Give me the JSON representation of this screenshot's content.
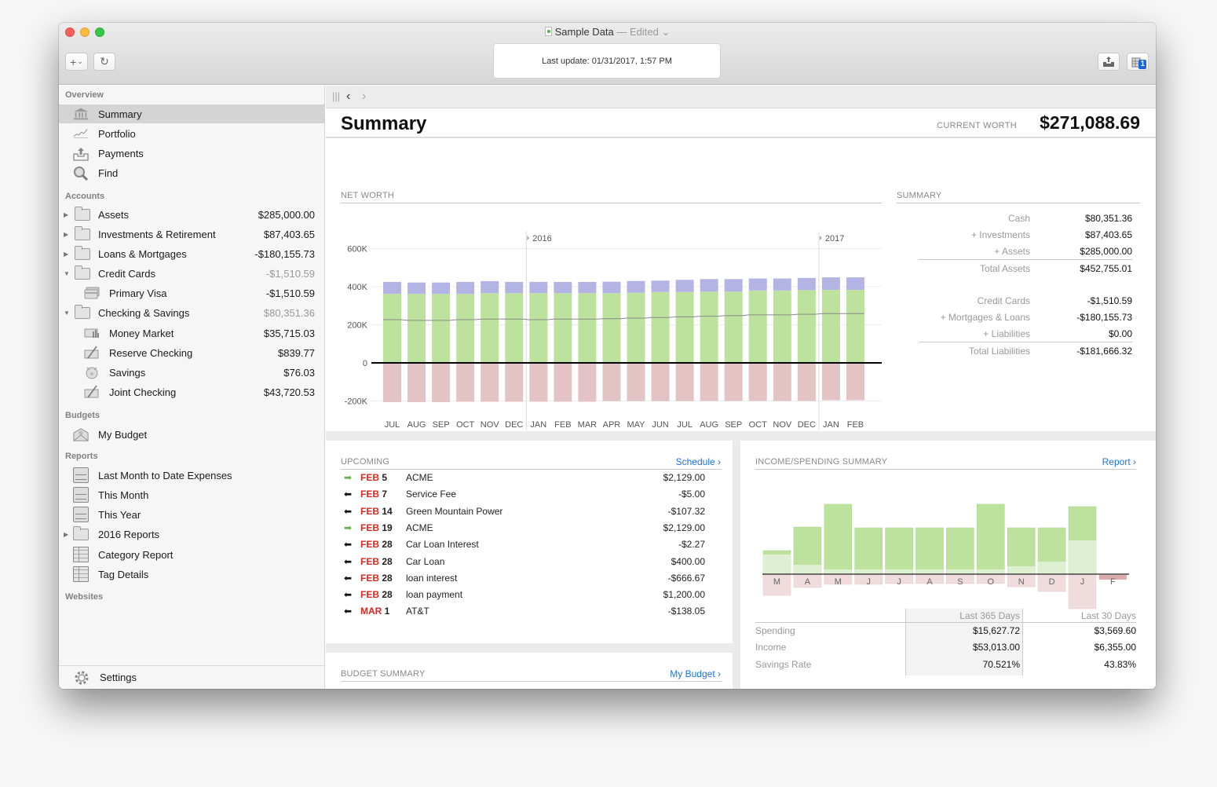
{
  "window": {
    "title": "Sample Data",
    "edited_label": "— Edited",
    "last_update": "Last update:  01/31/2017, 1:57 PM"
  },
  "toolbar": {
    "add_label": "+",
    "refresh_icon": "refresh-icon",
    "badge_count": "1"
  },
  "sidebar": {
    "sections": {
      "overview": "Overview",
      "accounts": "Accounts",
      "budgets": "Budgets",
      "reports": "Reports",
      "websites": "Websites"
    },
    "overview_items": [
      {
        "label": "Summary",
        "icon": "bank-icon",
        "selected": true
      },
      {
        "label": "Portfolio",
        "icon": "portfolio-chart-icon"
      },
      {
        "label": "Payments",
        "icon": "upload-tray-icon"
      },
      {
        "label": "Find",
        "icon": "magnifier-icon"
      }
    ],
    "accounts": [
      {
        "label": "Assets",
        "amount": "$285,000.00",
        "expanded": false
      },
      {
        "label": "Investments & Retirement",
        "amount": "$87,403.65",
        "expanded": false
      },
      {
        "label": "Loans & Mortgages",
        "amount": "-$180,155.73",
        "expanded": false
      },
      {
        "label": "Credit Cards",
        "amount": "-$1,510.59",
        "expanded": true
      },
      {
        "label": "Primary Visa",
        "amount": "-$1,510.59",
        "child": true
      },
      {
        "label": "Checking & Savings",
        "amount": "$80,351.36",
        "expanded": true
      },
      {
        "label": "Money Market",
        "amount": "$35,715.03",
        "child": true
      },
      {
        "label": "Reserve Checking",
        "amount": "$839.77",
        "child": true
      },
      {
        "label": "Savings",
        "amount": "$76.03",
        "child": true
      },
      {
        "label": "Joint Checking",
        "amount": "$43,720.53",
        "child": true
      }
    ],
    "budgets": [
      {
        "label": "My Budget"
      }
    ],
    "reports": [
      {
        "label": "Last Month to Date Expenses"
      },
      {
        "label": "This Month"
      },
      {
        "label": "This Year"
      },
      {
        "label": "2016 Reports"
      },
      {
        "label": "Category Report"
      },
      {
        "label": "Tag Details"
      }
    ],
    "settings_label": "Settings"
  },
  "page": {
    "title": "Summary",
    "current_worth_label": "CURRENT WORTH",
    "current_worth_value": "$271,088.69"
  },
  "net_worth": {
    "section_title": "NET WORTH"
  },
  "summary": {
    "section_title": "SUMMARY",
    "assets": [
      {
        "label": "Cash",
        "value": "$80,351.36"
      },
      {
        "label": "+ Investments",
        "value": "$87,403.65"
      },
      {
        "label": "+ Assets",
        "value": "$285,000.00"
      }
    ],
    "total_assets": {
      "label": "Total Assets",
      "value": "$452,755.01"
    },
    "liabilities": [
      {
        "label": "Credit Cards",
        "value": "-$1,510.59"
      },
      {
        "label": "+ Mortgages & Loans",
        "value": "-$180,155.73"
      },
      {
        "label": "+ Liabilities",
        "value": "$0.00"
      }
    ],
    "total_liabilities": {
      "label": "Total Liabilities",
      "value": "-$181,666.32"
    }
  },
  "upcoming": {
    "section_title": "UPCOMING",
    "link_label": "Schedule ›",
    "rows": [
      {
        "direction": "in",
        "month": "FEB",
        "day": "5",
        "payee": "ACME",
        "amount": "$2,129.00"
      },
      {
        "direction": "out",
        "month": "FEB",
        "day": "7",
        "payee": "Service Fee",
        "amount": "-$5.00"
      },
      {
        "direction": "out",
        "month": "FEB",
        "day": "14",
        "payee": "Green Mountain Power",
        "amount": "-$107.32"
      },
      {
        "direction": "in",
        "month": "FEB",
        "day": "19",
        "payee": "ACME",
        "amount": "$2,129.00"
      },
      {
        "direction": "out",
        "month": "FEB",
        "day": "28",
        "payee": "Car Loan Interest",
        "amount": "-$2.27"
      },
      {
        "direction": "out",
        "month": "FEB",
        "day": "28",
        "payee": "Car Loan",
        "amount": "$400.00"
      },
      {
        "direction": "out",
        "month": "FEB",
        "day": "28",
        "payee": "loan interest",
        "amount": "-$666.67"
      },
      {
        "direction": "out",
        "month": "FEB",
        "day": "28",
        "payee": "loan payment",
        "amount": "$1,200.00"
      },
      {
        "direction": "out",
        "month": "MAR",
        "day": "1",
        "payee": "AT&T",
        "amount": "-$138.05"
      }
    ]
  },
  "budget_summary": {
    "section_title": "BUDGET SUMMARY",
    "link_label": "My Budget ›"
  },
  "income_spending": {
    "section_title": "INCOME/SPENDING SUMMARY",
    "link_label": "Report ›",
    "table": {
      "columns": [
        "",
        "Last 365 Days",
        "Last 30 Days"
      ],
      "rows": [
        {
          "label": "Spending",
          "last_365": "$15,627.72",
          "last_30": "$3,569.60"
        },
        {
          "label": "Income",
          "last_365": "$53,013.00",
          "last_30": "$6,355.00"
        },
        {
          "label": "Savings Rate",
          "last_365": "70.521%",
          "last_30": "43.83%"
        }
      ]
    }
  },
  "colors": {
    "assets_green": "#bde29d",
    "investments_purple": "#b4b4e4",
    "liabilities_red": "#e4c3c4",
    "net_worth_line": "#8a8a8a",
    "link_blue": "#1a73e8",
    "date_red": "#e0281f",
    "income_arrow_green": "#6ab04c"
  },
  "chart_data": [
    {
      "type": "bar",
      "title": "NET WORTH",
      "stacked": true,
      "categories": [
        "JUL",
        "AUG",
        "SEP",
        "OCT",
        "NOV",
        "DEC",
        "JAN",
        "FEB",
        "MAR",
        "APR",
        "MAY",
        "JUN",
        "JUL",
        "AUG",
        "SEP",
        "OCT",
        "NOV",
        "DEC",
        "JAN",
        "FEB"
      ],
      "year_markers": [
        {
          "label": "2016",
          "before_index": 6
        },
        {
          "label": "2017",
          "before_index": 18
        }
      ],
      "series": [
        {
          "name": "Assets",
          "color": "#bde29d",
          "values": [
            362,
            362,
            362,
            362,
            366,
            366,
            366,
            366,
            366,
            366,
            368,
            372,
            372,
            374,
            374,
            380,
            380,
            382,
            383,
            383
          ]
        },
        {
          "name": "Investments",
          "color": "#b4b4e4",
          "values": [
            63,
            60,
            60,
            63,
            63,
            59,
            59,
            59,
            59,
            60,
            62,
            60,
            64,
            66,
            66,
            63,
            63,
            64,
            66,
            66
          ]
        },
        {
          "name": "Liabilities",
          "color": "#e4c3c4",
          "values": [
            -202,
            -202,
            -202,
            -200,
            -200,
            -200,
            -200,
            -200,
            -200,
            -197,
            -197,
            -197,
            -197,
            -196,
            -196,
            -196,
            -196,
            -196,
            -192,
            -192
          ]
        },
        {
          "name": "Net Worth",
          "type": "line",
          "color": "#8a8a8a",
          "values": [
            227,
            223,
            223,
            227,
            230,
            230,
            227,
            230,
            230,
            232,
            235,
            238,
            242,
            245,
            248,
            252,
            252,
            255,
            259,
            259
          ]
        }
      ],
      "yticks": [
        "-200K",
        "0",
        "200K",
        "400K",
        "600K"
      ],
      "ylim": [
        -200,
        600
      ],
      "yunit": "thousands USD",
      "grid": true,
      "xlabel": "",
      "ylabel": ""
    },
    {
      "type": "bar",
      "title": "INCOME/SPENDING SUMMARY",
      "categories": [
        "M",
        "A",
        "M",
        "J",
        "J",
        "A",
        "S",
        "O",
        "N",
        "D",
        "J",
        "F"
      ],
      "series": [
        {
          "name": "Income",
          "color": "#bde29d",
          "values": [
            30,
            60,
            89,
            59,
            59,
            59,
            59,
            89,
            59,
            59,
            86,
            0
          ]
        },
        {
          "name": "Savings",
          "color": "#dff0d2",
          "values": [
            25,
            12,
            6,
            6,
            6,
            6,
            6,
            6,
            10,
            16,
            43,
            0
          ]
        },
        {
          "name": "Spending",
          "color": "#f0dcdd",
          "values": [
            -27,
            -17,
            -13,
            -13,
            -12,
            -12,
            -12,
            -12,
            -16,
            -22,
            -44,
            -6
          ]
        }
      ],
      "yunit": "relative",
      "grid": false
    }
  ]
}
